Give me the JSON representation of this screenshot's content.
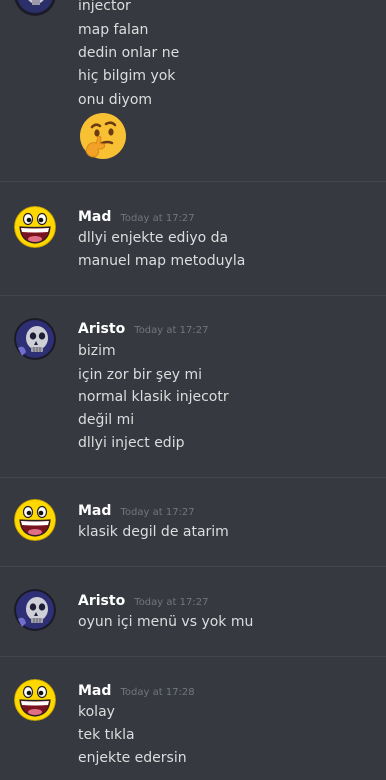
{
  "messages": [
    {
      "author": "",
      "timestamp": "",
      "lines": [
        "injector",
        "map falan",
        "dedin onlar ne",
        "hiç bilgim yok",
        "onu diyom"
      ],
      "emoji": "thinking-face"
    },
    {
      "author": "Mad",
      "timestamp": "Today at 17:27",
      "avatar": "awesome-face",
      "lines": [
        "dllyi enjekte ediyo da",
        "manuel map metoduyla"
      ]
    },
    {
      "author": "Aristo",
      "timestamp": "Today at 17:27",
      "avatar": "skull",
      "lines": [
        "bizim",
        "için zor bir şey mi",
        "normal klasik injecotr",
        "değil mi",
        "dllyi inject edip"
      ]
    },
    {
      "author": "Mad",
      "timestamp": "Today at 17:27",
      "avatar": "awesome-face",
      "lines": [
        "klasik degil de atarim"
      ]
    },
    {
      "author": "Aristo",
      "timestamp": "Today at 17:27",
      "avatar": "skull",
      "lines": [
        "oyun içi menü vs yok mu"
      ]
    },
    {
      "author": "Mad",
      "timestamp": "Today at 17:28",
      "avatar": "awesome-face",
      "lines": [
        "kolay",
        "tek tıkla",
        "enjekte edersin"
      ]
    }
  ],
  "colors": {
    "background": "#36393f",
    "text": "#dcddde",
    "author": "#ffffff",
    "timestamp": "#72767d",
    "divider": "#42454a"
  }
}
